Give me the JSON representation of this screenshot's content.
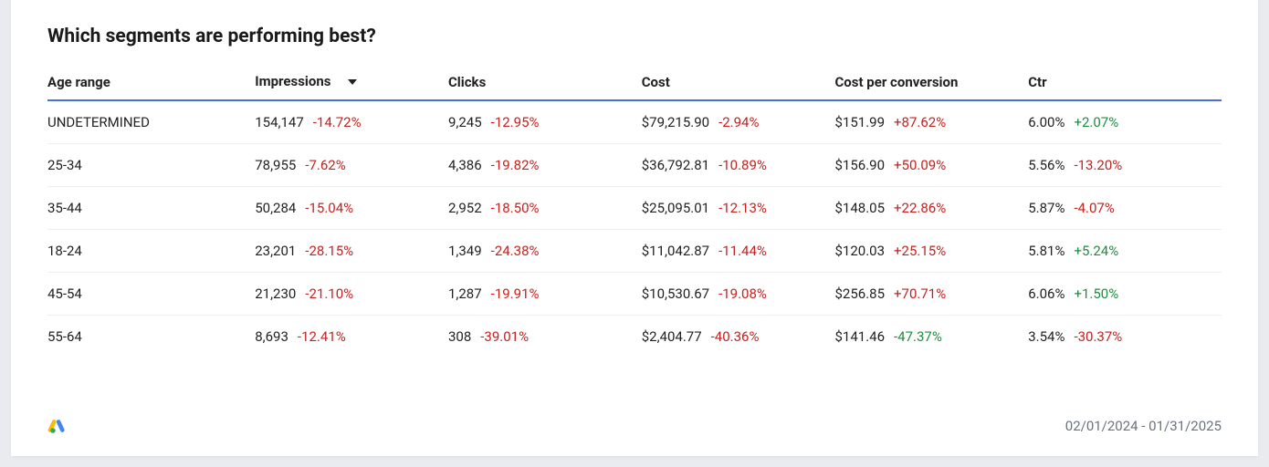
{
  "title": "Which segments are performing best?",
  "columns": [
    {
      "key": "age",
      "label": "Age range",
      "sorted": false
    },
    {
      "key": "impressions",
      "label": "Impressions",
      "sorted": true
    },
    {
      "key": "clicks",
      "label": "Clicks",
      "sorted": false
    },
    {
      "key": "cost",
      "label": "Cost",
      "sorted": false
    },
    {
      "key": "cpc",
      "label": "Cost per conversion",
      "sorted": false
    },
    {
      "key": "ctr",
      "label": "Ctr",
      "sorted": false
    }
  ],
  "rows": [
    {
      "age": "UNDETERMINED",
      "impressions": {
        "value": "154,147",
        "delta": "-14.72%",
        "dir": "neg"
      },
      "clicks": {
        "value": "9,245",
        "delta": "-12.95%",
        "dir": "neg"
      },
      "cost": {
        "value": "$79,215.90",
        "delta": "-2.94%",
        "dir": "neg"
      },
      "cpc": {
        "value": "$151.99",
        "delta": "+87.62%",
        "dir": "neg"
      },
      "ctr": {
        "value": "6.00%",
        "delta": "+2.07%",
        "dir": "pos"
      }
    },
    {
      "age": "25-34",
      "impressions": {
        "value": "78,955",
        "delta": "-7.62%",
        "dir": "neg"
      },
      "clicks": {
        "value": "4,386",
        "delta": "-19.82%",
        "dir": "neg"
      },
      "cost": {
        "value": "$36,792.81",
        "delta": "-10.89%",
        "dir": "neg"
      },
      "cpc": {
        "value": "$156.90",
        "delta": "+50.09%",
        "dir": "neg"
      },
      "ctr": {
        "value": "5.56%",
        "delta": "-13.20%",
        "dir": "neg"
      }
    },
    {
      "age": "35-44",
      "impressions": {
        "value": "50,284",
        "delta": "-15.04%",
        "dir": "neg"
      },
      "clicks": {
        "value": "2,952",
        "delta": "-18.50%",
        "dir": "neg"
      },
      "cost": {
        "value": "$25,095.01",
        "delta": "-12.13%",
        "dir": "neg"
      },
      "cpc": {
        "value": "$148.05",
        "delta": "+22.86%",
        "dir": "neg"
      },
      "ctr": {
        "value": "5.87%",
        "delta": "-4.07%",
        "dir": "neg"
      }
    },
    {
      "age": "18-24",
      "impressions": {
        "value": "23,201",
        "delta": "-28.15%",
        "dir": "neg"
      },
      "clicks": {
        "value": "1,349",
        "delta": "-24.38%",
        "dir": "neg"
      },
      "cost": {
        "value": "$11,042.87",
        "delta": "-11.44%",
        "dir": "neg"
      },
      "cpc": {
        "value": "$120.03",
        "delta": "+25.15%",
        "dir": "neg"
      },
      "ctr": {
        "value": "5.81%",
        "delta": "+5.24%",
        "dir": "pos"
      }
    },
    {
      "age": "45-54",
      "impressions": {
        "value": "21,230",
        "delta": "-21.10%",
        "dir": "neg"
      },
      "clicks": {
        "value": "1,287",
        "delta": "-19.91%",
        "dir": "neg"
      },
      "cost": {
        "value": "$10,530.67",
        "delta": "-19.08%",
        "dir": "neg"
      },
      "cpc": {
        "value": "$256.85",
        "delta": "+70.71%",
        "dir": "neg"
      },
      "ctr": {
        "value": "6.06%",
        "delta": "+1.50%",
        "dir": "pos"
      }
    },
    {
      "age": "55-64",
      "impressions": {
        "value": "8,693",
        "delta": "-12.41%",
        "dir": "neg"
      },
      "clicks": {
        "value": "308",
        "delta": "-39.01%",
        "dir": "neg"
      },
      "cost": {
        "value": "$2,404.77",
        "delta": "-40.36%",
        "dir": "neg"
      },
      "cpc": {
        "value": "$141.46",
        "delta": "-47.37%",
        "dir": "pos"
      },
      "ctr": {
        "value": "3.54%",
        "delta": "-30.37%",
        "dir": "neg"
      }
    }
  ],
  "footer": {
    "date_range": "02/01/2024 - 01/31/2025",
    "logo": "google-ads"
  }
}
